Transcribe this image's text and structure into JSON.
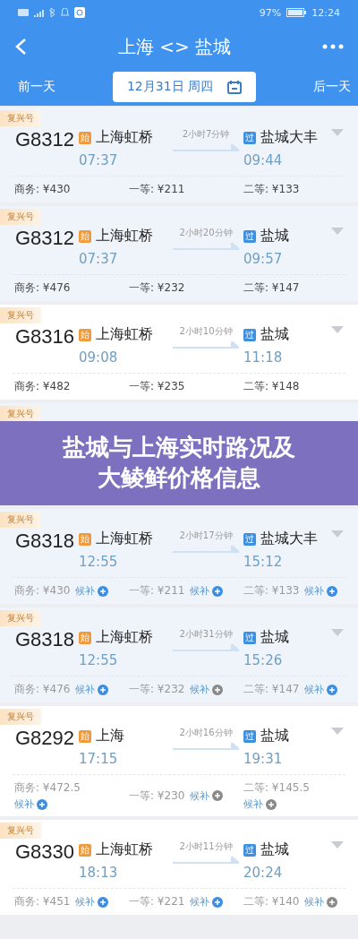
{
  "status_bar": {
    "battery_text": "97%",
    "time": "12:24"
  },
  "header": {
    "title": "上海 <> 盐城",
    "prev_day": "前一天",
    "date": "12月31日 周四",
    "next_day": "后一天"
  },
  "trains": [
    {
      "tag": "复兴号",
      "number": "G8312",
      "from_badge": "始",
      "from": "上海虹桥",
      "depart": "07:37",
      "duration": "2小时7分钟",
      "to_badge": "过",
      "to": "盐城大丰",
      "arrive": "09:44",
      "highlighted": true,
      "prices": [
        {
          "label": "商务:",
          "price": "¥430"
        },
        {
          "label": "一等:",
          "price": "¥211"
        },
        {
          "label": "二等:",
          "price": "¥133"
        }
      ]
    },
    {
      "tag": "复兴号",
      "number": "G8312",
      "from_badge": "始",
      "from": "上海虹桥",
      "depart": "07:37",
      "duration": "2小时20分钟",
      "to_badge": "过",
      "to": "盐城",
      "arrive": "09:57",
      "highlighted": true,
      "prices": [
        {
          "label": "商务:",
          "price": "¥476"
        },
        {
          "label": "一等:",
          "price": "¥232"
        },
        {
          "label": "二等:",
          "price": "¥147"
        }
      ]
    },
    {
      "tag": "复兴号",
      "number": "G8316",
      "from_badge": "始",
      "from": "上海虹桥",
      "depart": "09:08",
      "duration": "2小时10分钟",
      "to_badge": "过",
      "to": "盐城",
      "arrive": "11:18",
      "highlighted": false,
      "prices": [
        {
          "label": "商务:",
          "price": "¥482"
        },
        {
          "label": "一等:",
          "price": "¥235"
        },
        {
          "label": "二等:",
          "price": "¥148"
        }
      ]
    },
    {
      "kind": "covered",
      "tag": "复兴号",
      "highlighted": true
    },
    {
      "kind": "banner",
      "lines": [
        "盐城与上海实时路况及",
        "大鲮鲜价格信息"
      ]
    },
    {
      "tag": "复兴号",
      "number": "G8318",
      "from_badge": "始",
      "from": "上海虹桥",
      "depart": "12:55",
      "duration": "2小时17分钟",
      "to_badge": "过",
      "to": "盐城大丰",
      "arrive": "15:12",
      "highlighted": true,
      "prices": [
        {
          "label": "商务:",
          "price": "¥430",
          "waitlist": {
            "label": "候补",
            "available": true
          }
        },
        {
          "label": "一等:",
          "price": "¥211",
          "waitlist": {
            "label": "候补",
            "available": true
          }
        },
        {
          "label": "二等:",
          "price": "¥133",
          "waitlist": {
            "label": "候补",
            "available": true
          }
        }
      ]
    },
    {
      "tag": "复兴号",
      "number": "G8318",
      "from_badge": "始",
      "from": "上海虹桥",
      "depart": "12:55",
      "duration": "2小时31分钟",
      "to_badge": "过",
      "to": "盐城",
      "arrive": "15:26",
      "highlighted": true,
      "prices": [
        {
          "label": "商务:",
          "price": "¥476",
          "waitlist": {
            "label": "候补",
            "available": true
          }
        },
        {
          "label": "一等:",
          "price": "¥232",
          "waitlist": {
            "label": "候补",
            "available": false
          }
        },
        {
          "label": "二等:",
          "price": "¥147",
          "waitlist": {
            "label": "候补",
            "available": true
          }
        }
      ]
    },
    {
      "tag": "复兴号",
      "number": "G8292",
      "from_badge": "始",
      "from": "上海",
      "depart": "17:15",
      "duration": "2小时16分钟",
      "to_badge": "过",
      "to": "盐城",
      "arrive": "19:31",
      "highlighted": false,
      "prices": [
        {
          "label": "商务:",
          "price": "¥472.5",
          "stacked": true,
          "waitlist": {
            "label": "候补",
            "available": true
          }
        },
        {
          "label": "一等:",
          "price": "¥230",
          "waitlist": {
            "label": "候补",
            "available": false
          }
        },
        {
          "label": "二等:",
          "price": "¥145.5",
          "stacked": true,
          "waitlist": {
            "label": "候补",
            "available": false
          }
        }
      ]
    },
    {
      "tag": "复兴号",
      "number": "G8330",
      "from_badge": "始",
      "from": "上海虹桥",
      "depart": "18:13",
      "duration": "2小时11分钟",
      "to_badge": "过",
      "to": "盐城",
      "arrive": "20:24",
      "highlighted": false,
      "prices": [
        {
          "label": "商务:",
          "price": "¥451",
          "waitlist": {
            "label": "候补",
            "available": true
          }
        },
        {
          "label": "一等:",
          "price": "¥221",
          "waitlist": {
            "label": "候补",
            "available": true
          }
        },
        {
          "label": "二等:",
          "price": "¥140",
          "waitlist": {
            "label": "候补",
            "available": false
          }
        }
      ]
    }
  ]
}
